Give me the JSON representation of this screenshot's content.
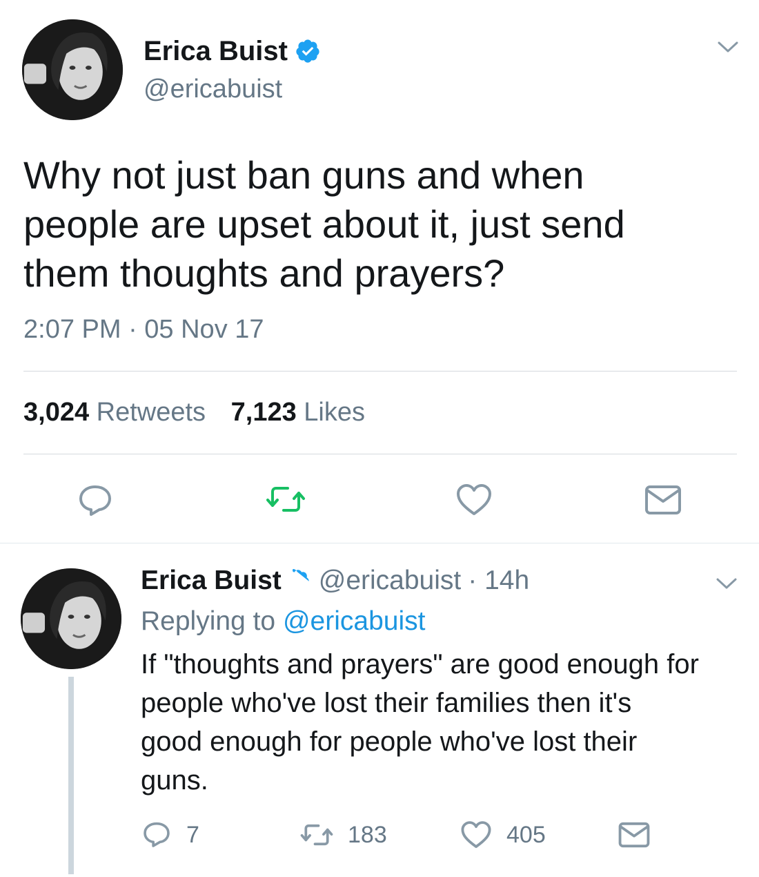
{
  "main_tweet": {
    "author_name": "Erica Buist",
    "author_handle": "@ericabuist",
    "text_lines": [
      "Why not just ban guns and when",
      "people are upset about it, just send",
      "them thoughts and prayers?"
    ],
    "timestamp": "2:07 PM · 05 Nov 17",
    "retweets_count": "3,024",
    "retweets_label": "Retweets",
    "likes_count": "7,123",
    "likes_label": "Likes"
  },
  "reply_tweet": {
    "author_name": "Erica Buist",
    "author_handle": "@ericabuist",
    "time_ago": "· 14h",
    "replying_prefix": "Replying to",
    "replying_handle": "@ericabuist",
    "text_lines": [
      "If \"thoughts and prayers\" are good enough for",
      "people who've lost their families then it's",
      "good enough for people who've lost their",
      "guns."
    ],
    "reply_count": "7",
    "retweet_count": "183",
    "like_count": "405"
  },
  "icons": {
    "menu": "chevron-down-icon",
    "verified": "verified-badge-icon",
    "reply": "reply-icon",
    "retweet": "retweet-icon",
    "like": "heart-icon",
    "message": "envelope-icon"
  },
  "colors": {
    "verified_blue": "#1da1f2",
    "retweet_green": "#17bf63",
    "link_blue": "#1b95e0",
    "secondary_text": "#657786",
    "thread_line": "#ccd6dd"
  }
}
